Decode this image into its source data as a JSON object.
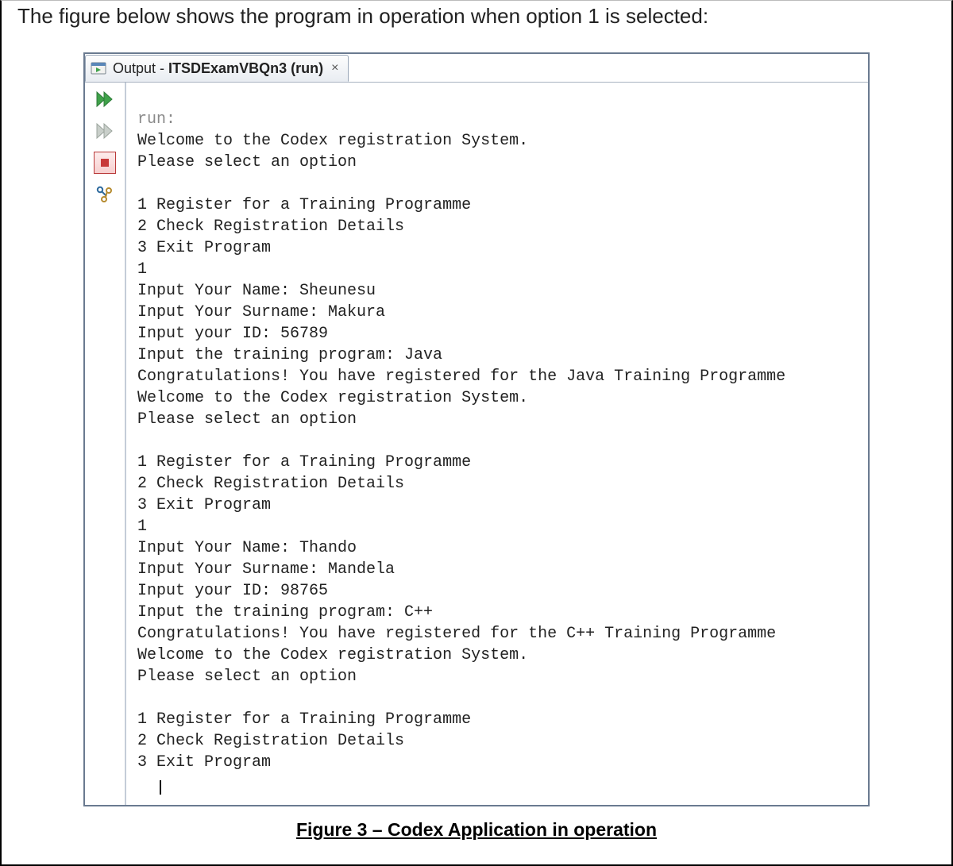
{
  "intro_text": "The figure below shows the program in operation when option 1 is selected:",
  "tab": {
    "prefix": "Output - ",
    "name": "ITSDExamVBQn3 (run)",
    "close_glyph": "×"
  },
  "gutter": {
    "rerun_icon": "double-play-green",
    "rerun2_icon": "double-play-grey",
    "stop_icon": "stop",
    "settings_icon": "wrench-percent"
  },
  "console": {
    "run_label": "run:",
    "lines": [
      "Welcome to the Codex registration System.",
      "Please select an option",
      "",
      "1 Register for a Training Programme",
      "2 Check Registration Details",
      "3 Exit Program",
      "1",
      "Input Your Name: Sheunesu",
      "Input Your Surname: Makura",
      "Input your ID: 56789",
      "Input the training program: Java",
      "Congratulations! You have registered for the Java Training Programme",
      "Welcome to the Codex registration System.",
      "Please select an option",
      "",
      "1 Register for a Training Programme",
      "2 Check Registration Details",
      "3 Exit Program",
      "1",
      "Input Your Name: Thando",
      "Input Your Surname: Mandela",
      "Input your ID: 98765",
      "Input the training program: C++",
      "Congratulations! You have registered for the C++ Training Programme",
      "Welcome to the Codex registration System.",
      "Please select an option",
      "",
      "1 Register for a Training Programme",
      "2 Check Registration Details",
      "3 Exit Program"
    ]
  },
  "caption": "Figure 3 – Codex Application in operation"
}
